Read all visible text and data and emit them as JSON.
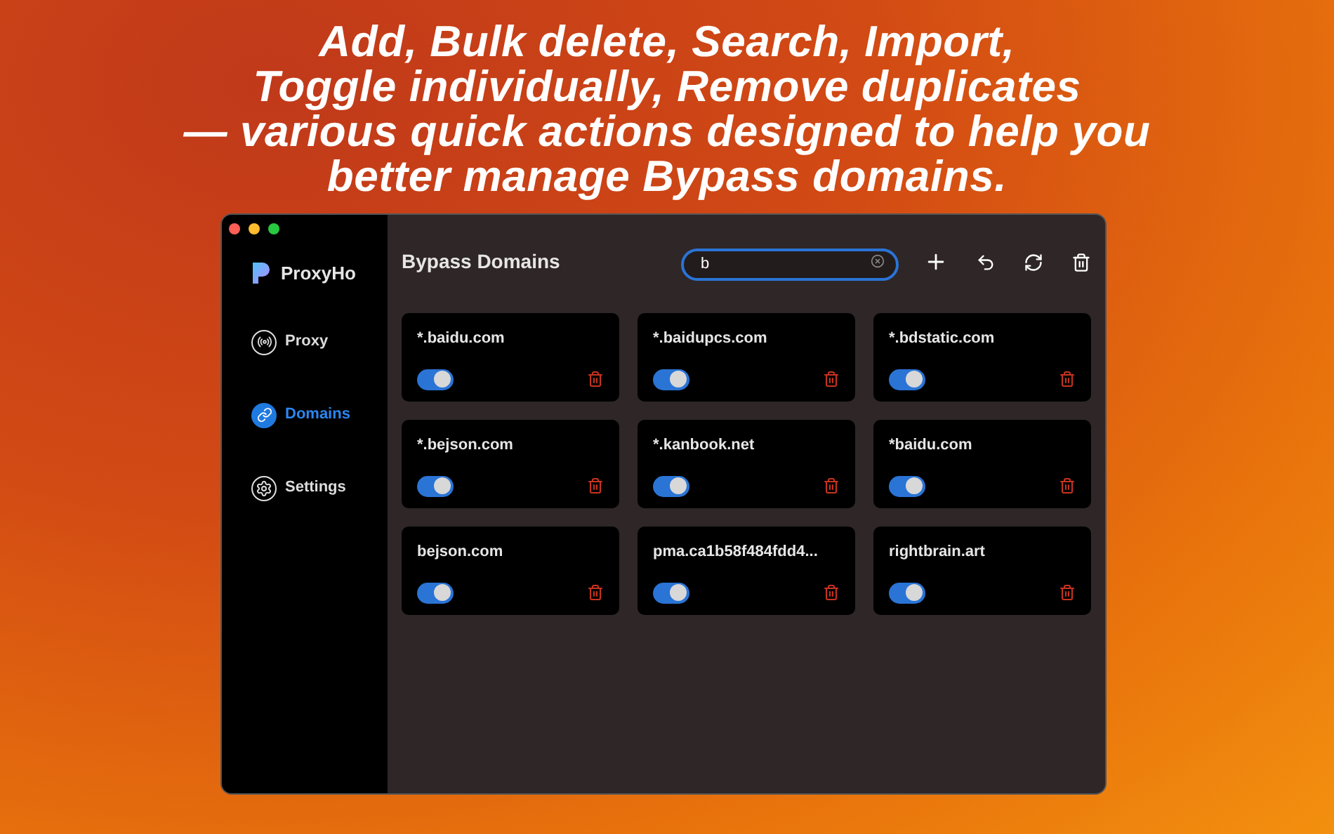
{
  "headline": [
    "Add, Bulk delete, Search, Import,",
    "Toggle individually, Remove duplicates",
    "— various quick actions designed to help you",
    "better manage Bypass domains."
  ],
  "sidebar": {
    "app_name": "ProxyHo",
    "items": [
      {
        "label": "Proxy",
        "kind": "proxy",
        "selected": false
      },
      {
        "label": "Domains",
        "kind": "domains",
        "selected": true
      },
      {
        "label": "Settings",
        "kind": "settings",
        "selected": false
      }
    ]
  },
  "main": {
    "title": "Bypass Domains",
    "search": {
      "value": "b"
    },
    "domains": [
      {
        "name": "*.baidu.com",
        "on": true
      },
      {
        "name": "*.baidupcs.com",
        "on": true
      },
      {
        "name": "*.bdstatic.com",
        "on": true
      },
      {
        "name": "*.bejson.com",
        "on": true
      },
      {
        "name": "*.kanbook.net",
        "on": true
      },
      {
        "name": "*baidu.com",
        "on": true
      },
      {
        "name": "bejson.com",
        "on": true
      },
      {
        "name": "pma.ca1b58f484fdd4...",
        "on": true
      },
      {
        "name": "rightbrain.art",
        "on": true
      }
    ]
  }
}
